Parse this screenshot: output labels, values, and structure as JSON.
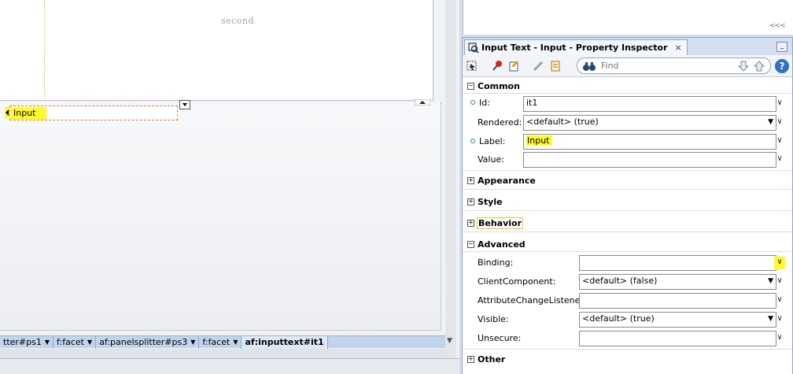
{
  "canvas": {
    "second_label": "second",
    "input_label": "Input"
  },
  "breadcrumbs": [
    {
      "label": "tter#ps1",
      "active": false
    },
    {
      "label": "f:facet",
      "active": false
    },
    {
      "label": "af:panelsplitter#ps3",
      "active": false
    },
    {
      "label": "f:facet",
      "active": false
    },
    {
      "label": "af:inputtext#it1",
      "active": true
    }
  ],
  "inspector": {
    "tab_title": "Input Text - Input - Property Inspector",
    "close_glyph": "×",
    "find_placeholder": "Find",
    "help_glyph": "?",
    "sections": {
      "common": "Common",
      "appearance": "Appearance",
      "style": "Style",
      "behavior": "Behavior",
      "advanced": "Advanced",
      "other": "Other"
    },
    "common": {
      "id_label": "Id:",
      "id_value": "it1",
      "rendered_label": "Rendered:",
      "rendered_value": "<default> (true)",
      "label_label": "Label:",
      "label_value": "Input",
      "value_label": "Value:",
      "value_value": ""
    },
    "advanced": {
      "binding_label": "Binding:",
      "binding_value": "",
      "client_component_label": "ClientComponent:",
      "client_component_value": "<default> (false)",
      "attr_change_label": "AttributeChangeListener:",
      "attr_change_value": "",
      "visible_label": "Visible:",
      "visible_value": "<default> (true)",
      "unsecure_label": "Unsecure:",
      "unsecure_value": ""
    }
  },
  "colors": {
    "highlight": "#fffb2a",
    "tab_bar": "#d4e0f1",
    "breadcrumb_bar": "#c2d4ec",
    "input_outline": "#e07a3a"
  },
  "icons": [
    "property-inspector-icon",
    "select-icon",
    "pin-icon",
    "edit-icon",
    "binoculars-icon",
    "down-arrow-icon",
    "up-arrow-icon",
    "help-icon",
    "chevron-down-icon",
    "minimize-icon"
  ]
}
